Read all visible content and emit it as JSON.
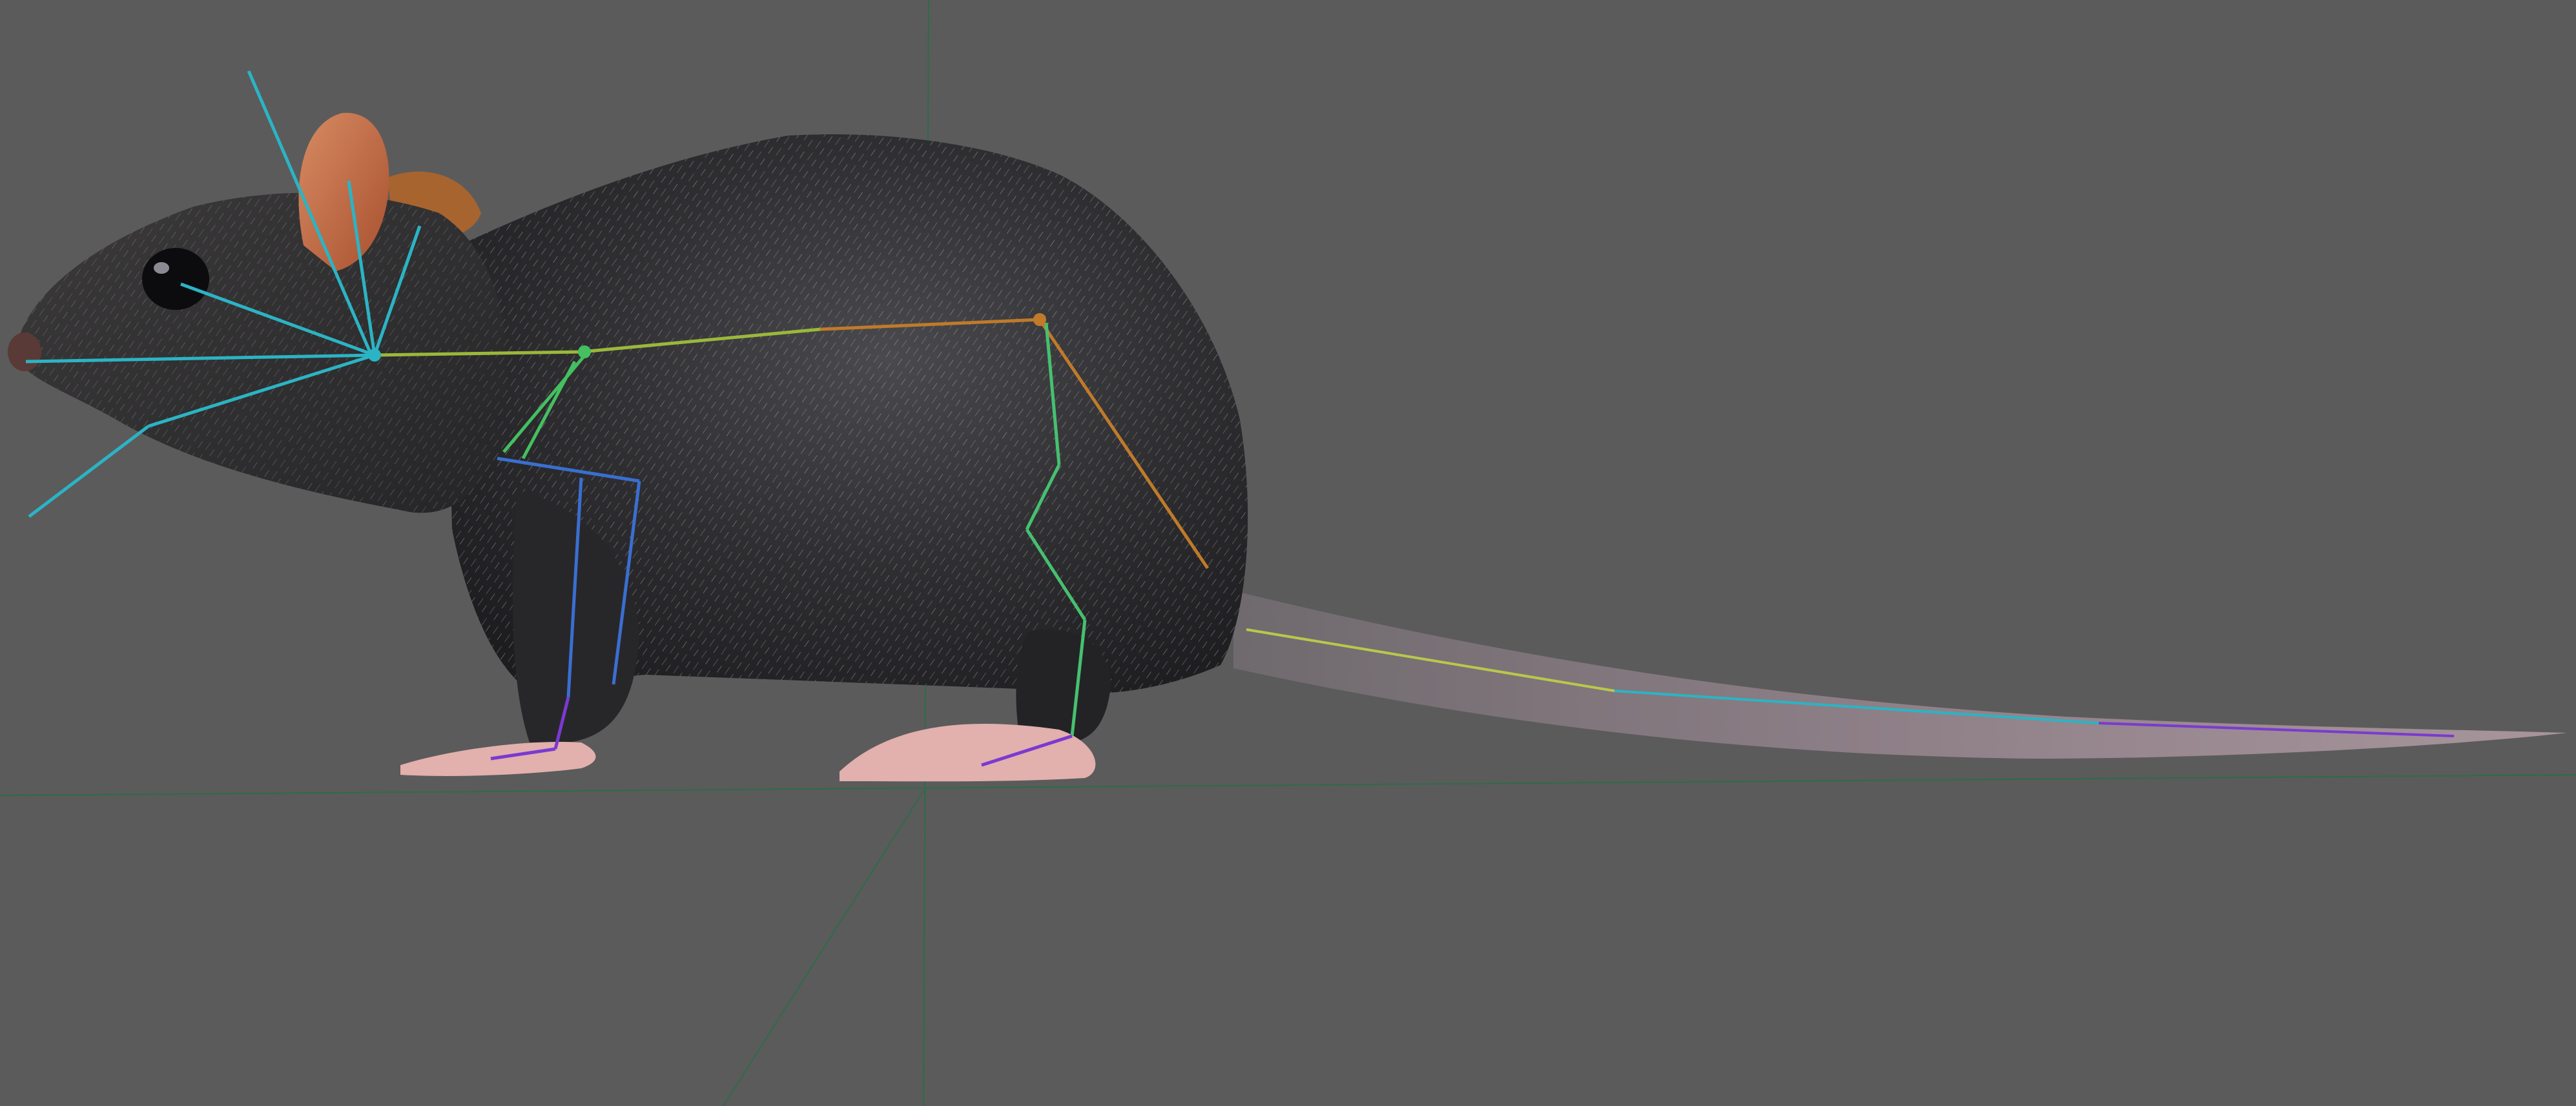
{
  "viewport": {
    "background_color": "#5b5b5b",
    "grid_axis_color": "#2f6b4a",
    "projection": "orthographic-side",
    "shading": "textured"
  },
  "model": {
    "subject": "rat",
    "fur_color": "#2b2b2d",
    "fur_highlight": "#9a9aa0",
    "ear_color": "#c8704e",
    "paw_color": "#e2b0ad",
    "tail_color": "#8f8088",
    "eye_color": "#0c0c0e"
  },
  "skeleton": {
    "visible": true,
    "bone_colors": {
      "head": "#2bb4c4",
      "spine": "#9ab83a",
      "hip": "#c07a2a",
      "front_leg": "#3a6fd0",
      "front_paw": "#7a3ad0",
      "hind_leg": "#46c070",
      "tail": "#b8c84a",
      "neck": "#44c060"
    }
  }
}
